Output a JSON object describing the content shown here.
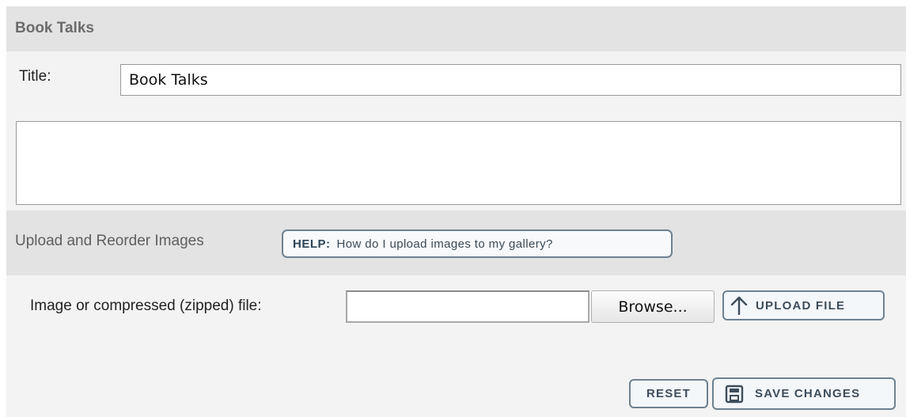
{
  "section1": {
    "title": "Book Talks"
  },
  "form": {
    "title_label": "Title:",
    "title_value": "Book Talks",
    "description_value": ""
  },
  "section2": {
    "title": "Upload and Reorder Images",
    "help_prefix": "HELP:",
    "help_text": "How do I upload images to my gallery?"
  },
  "upload": {
    "file_label": "Image or compressed (zipped) file:",
    "browse_label": "Browse...",
    "upload_label": "UPLOAD FILE",
    "upload_icon": "arrow-up-icon"
  },
  "actions": {
    "reset_label": "RESET",
    "save_label": "SAVE CHANGES",
    "save_icon": "floppy-disk-icon"
  },
  "colors": {
    "panel_bg": "#f3f3f3",
    "header_bg": "#e3e3e3",
    "button_border": "#6d8191",
    "button_text": "#3d4d5b"
  }
}
